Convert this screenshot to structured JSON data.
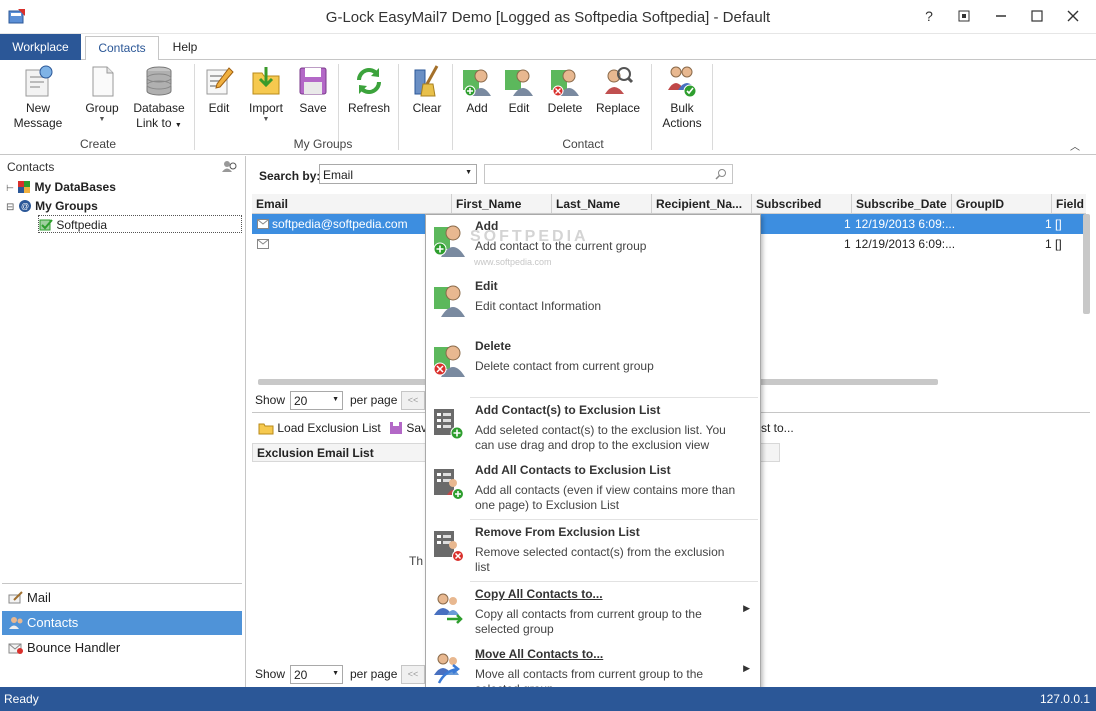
{
  "window": {
    "title": "G-Lock EasyMail7 Demo [Logged as Softpedia Softpedia] - Default",
    "help_button": "?"
  },
  "ribbon": {
    "tabs": [
      "Workplace",
      "Contacts",
      "Help"
    ],
    "buttons": {
      "new_message": [
        "New",
        "Message"
      ],
      "group": "Group",
      "database_link": [
        "Database",
        "Link to"
      ],
      "edit": "Edit",
      "import": "Import",
      "save": "Save",
      "refresh": "Refresh",
      "clear": "Clear",
      "add": "Add",
      "edit_contact": "Edit",
      "delete": "Delete",
      "replace": "Replace",
      "bulk_actions": [
        "Bulk",
        "Actions"
      ]
    },
    "groups": [
      "Create",
      "My Groups",
      "Contact"
    ]
  },
  "left": {
    "header": "Contacts",
    "tree": {
      "databases": "My DataBases",
      "groups": "My Groups",
      "softpedia": "Softpedia"
    },
    "nav": [
      "Mail",
      "Contacts",
      "Bounce Handler"
    ]
  },
  "search": {
    "label": "Search by:",
    "field": "Email",
    "value": ""
  },
  "grid": {
    "columns": [
      "Email",
      "First_Name",
      "Last_Name",
      "Recipient_Na...",
      "Subscribed",
      "Subscribe_Date",
      "GroupID",
      "Field"
    ],
    "rows": [
      {
        "email": "softpedia@softpedia.com",
        "subscribed": "1",
        "date": "12/19/2013 6:09:...",
        "group": "1",
        "field": "[]"
      },
      {
        "email": "",
        "subscribed": "1",
        "date": "12/19/2013 6:09:...",
        "group": "1",
        "field": "[]"
      }
    ],
    "show_label": "Show",
    "per_page_value": "20",
    "per_page_label": "per page",
    "pager_prev": "<<"
  },
  "exclusion": {
    "load_label": "Load Exclusion List",
    "save_label": "Sav",
    "copy_label": "st to...",
    "header": "Exclusion Email List",
    "empty_text": "Th",
    "show_label": "Show",
    "per_page_value": "20",
    "per_page_label": "per page",
    "pager_prev": "<<"
  },
  "context_menu": [
    {
      "title": "Add",
      "desc": "Add contact to the current group"
    },
    {
      "title": "Edit",
      "desc": "Edit contact Information"
    },
    {
      "title": "Delete",
      "desc": "Delete contact from current group"
    },
    {
      "title": "Add Contact(s) to Exclusion List",
      "desc": "Add seleted contact(s) to the exclusion list. You can use drag and drop to the exclusion view"
    },
    {
      "title": "Add All Contacts to Exclusion List",
      "desc": "Add all contacts (even if view contains more than one page) to Exclusion List"
    },
    {
      "title": "Remove From Exclusion List",
      "desc": "Remove selected contact(s) from the exclusion list"
    },
    {
      "title": "Copy All Contacts to...",
      "desc": "Copy all contacts from current group to the selected group"
    },
    {
      "title": "Move All Contacts to...",
      "desc": "Move all contacts from current group to the selected group"
    }
  ],
  "watermark": "SOFTPEDIA",
  "watermark_url": "www.softpedia.com",
  "status": {
    "left": "Ready",
    "right": "127.0.0.1"
  },
  "colors": {
    "accent": "#2b5797",
    "selection": "#3d8ee0",
    "nav_active": "#4f93d8"
  }
}
